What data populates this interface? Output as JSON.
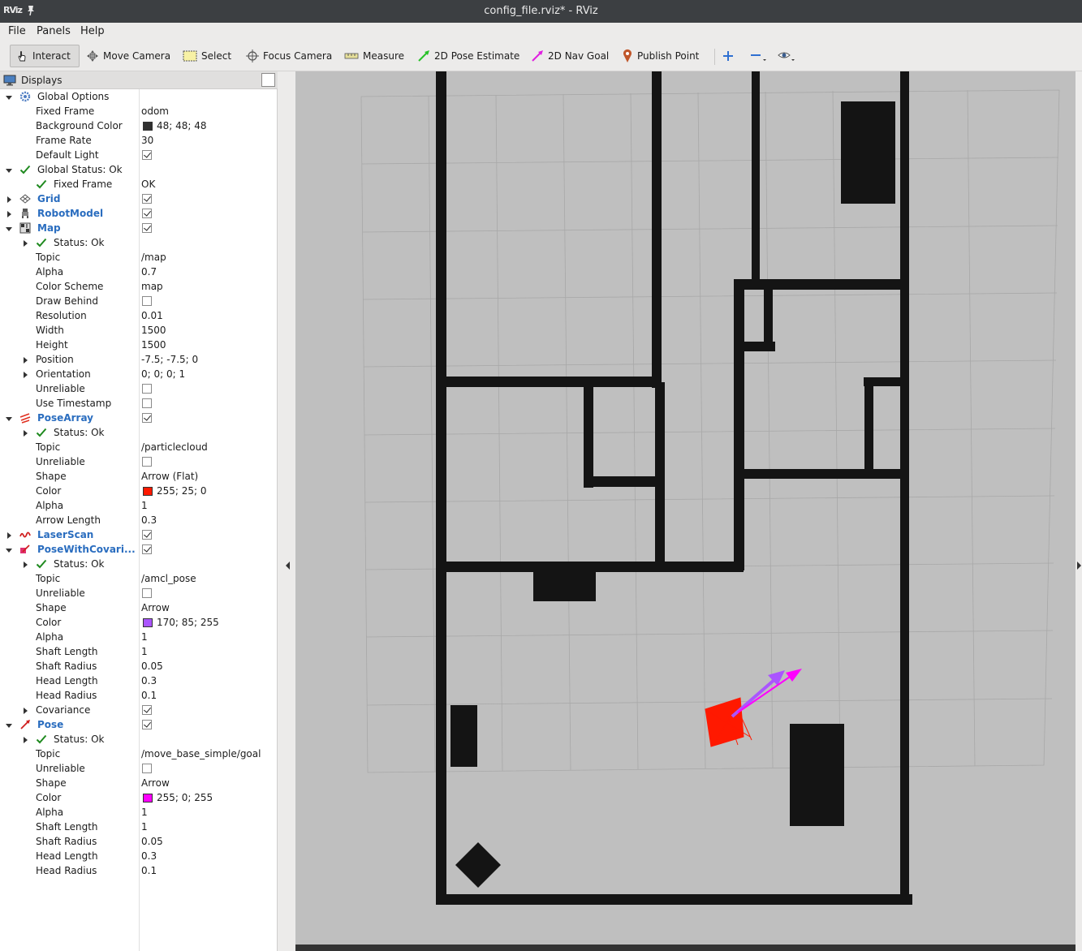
{
  "window": {
    "logo": "RViz",
    "title": "config_file.rviz* - RViz"
  },
  "menu": [
    "File",
    "Panels",
    "Help"
  ],
  "toolbar": {
    "interact": "Interact",
    "move_camera": "Move Camera",
    "select": "Select",
    "focus_camera": "Focus Camera",
    "measure": "Measure",
    "pose_estimate": "2D Pose Estimate",
    "nav_goal": "2D Nav Goal",
    "publish_point": "Publish Point"
  },
  "displays_panel": {
    "title": "Displays",
    "rows": [
      {
        "indent": 0,
        "arrow": "down",
        "icon": "gear-icon",
        "name": "Global Options",
        "group": false
      },
      {
        "indent": 1,
        "name": "Fixed Frame",
        "value": "odom"
      },
      {
        "indent": 1,
        "name": "Background Color",
        "color": "#303030",
        "value": "48; 48; 48"
      },
      {
        "indent": 1,
        "name": "Frame Rate",
        "value": "30"
      },
      {
        "indent": 1,
        "name": "Default Light",
        "checkbox": true
      },
      {
        "indent": 0,
        "arrow": "down",
        "icon": "check-icon",
        "name": "Global Status: Ok"
      },
      {
        "indent": 1,
        "icon": "check-icon",
        "name": "Fixed Frame",
        "value": "OK"
      },
      {
        "indent": 0,
        "arrow": "right",
        "icon": "grid-icon",
        "name": "Grid",
        "group": true,
        "checkbox": true
      },
      {
        "indent": 0,
        "arrow": "right",
        "icon": "robot-icon",
        "name": "RobotModel",
        "group": true,
        "checkbox": true
      },
      {
        "indent": 0,
        "arrow": "down",
        "icon": "map-icon",
        "name": "Map",
        "group": true,
        "checkbox": true
      },
      {
        "indent": 1,
        "arrow": "right",
        "icon": "check-icon",
        "name": "Status: Ok"
      },
      {
        "indent": 1,
        "name": "Topic",
        "value": "/map"
      },
      {
        "indent": 1,
        "name": "Alpha",
        "value": "0.7"
      },
      {
        "indent": 1,
        "name": "Color Scheme",
        "value": "map"
      },
      {
        "indent": 1,
        "name": "Draw Behind",
        "checkbox": false
      },
      {
        "indent": 1,
        "name": "Resolution",
        "value": "0.01"
      },
      {
        "indent": 1,
        "name": "Width",
        "value": "1500"
      },
      {
        "indent": 1,
        "name": "Height",
        "value": "1500"
      },
      {
        "indent": 1,
        "arrow": "right",
        "name": "Position",
        "value": "-7.5; -7.5; 0"
      },
      {
        "indent": 1,
        "arrow": "right",
        "name": "Orientation",
        "value": "0; 0; 0; 1"
      },
      {
        "indent": 1,
        "name": "Unreliable",
        "checkbox": false
      },
      {
        "indent": 1,
        "name": "Use Timestamp",
        "checkbox": false
      },
      {
        "indent": 0,
        "arrow": "down",
        "icon": "posearray-icon",
        "name": "PoseArray",
        "group": true,
        "checkbox": true
      },
      {
        "indent": 1,
        "arrow": "right",
        "icon": "check-icon",
        "name": "Status: Ok"
      },
      {
        "indent": 1,
        "name": "Topic",
        "value": "/particlecloud"
      },
      {
        "indent": 1,
        "name": "Unreliable",
        "checkbox": false
      },
      {
        "indent": 1,
        "name": "Shape",
        "value": "Arrow (Flat)"
      },
      {
        "indent": 1,
        "name": "Color",
        "color": "#ff1900",
        "value": "255; 25; 0"
      },
      {
        "indent": 1,
        "name": "Alpha",
        "value": "1"
      },
      {
        "indent": 1,
        "name": "Arrow Length",
        "value": "0.3"
      },
      {
        "indent": 0,
        "arrow": "right",
        "icon": "laserscan-icon",
        "name": "LaserScan",
        "group": true,
        "checkbox": true
      },
      {
        "indent": 0,
        "arrow": "down",
        "icon": "posecov-icon",
        "name": "PoseWithCovari...",
        "group": true,
        "checkbox": true
      },
      {
        "indent": 1,
        "arrow": "right",
        "icon": "check-icon",
        "name": "Status: Ok"
      },
      {
        "indent": 1,
        "name": "Topic",
        "value": "/amcl_pose"
      },
      {
        "indent": 1,
        "name": "Unreliable",
        "checkbox": false
      },
      {
        "indent": 1,
        "name": "Shape",
        "value": "Arrow"
      },
      {
        "indent": 1,
        "name": "Color",
        "color": "#aa55ff",
        "value": "170; 85; 255"
      },
      {
        "indent": 1,
        "name": "Alpha",
        "value": "1"
      },
      {
        "indent": 1,
        "name": "Shaft Length",
        "value": "1"
      },
      {
        "indent": 1,
        "name": "Shaft Radius",
        "value": "0.05"
      },
      {
        "indent": 1,
        "name": "Head Length",
        "value": "0.3"
      },
      {
        "indent": 1,
        "name": "Head Radius",
        "value": "0.1"
      },
      {
        "indent": 1,
        "arrow": "right",
        "name": "Covariance",
        "checkbox": true
      },
      {
        "indent": 0,
        "arrow": "down",
        "icon": "pose-icon",
        "name": "Pose",
        "group": true,
        "checkbox": true
      },
      {
        "indent": 1,
        "arrow": "right",
        "icon": "check-icon",
        "name": "Status: Ok"
      },
      {
        "indent": 1,
        "name": "Topic",
        "value": "/move_base_simple/goal"
      },
      {
        "indent": 1,
        "name": "Unreliable",
        "checkbox": false
      },
      {
        "indent": 1,
        "name": "Shape",
        "value": "Arrow"
      },
      {
        "indent": 1,
        "name": "Color",
        "color": "#ff00ff",
        "value": "255; 0; 255"
      },
      {
        "indent": 1,
        "name": "Alpha",
        "value": "1"
      },
      {
        "indent": 1,
        "name": "Shaft Length",
        "value": "1"
      },
      {
        "indent": 1,
        "name": "Shaft Radius",
        "value": "0.05"
      },
      {
        "indent": 1,
        "name": "Head Length",
        "value": "0.3"
      },
      {
        "indent": 1,
        "name": "Head Radius",
        "value": "0.1"
      }
    ]
  },
  "viewport": {
    "background": "#bfbfbf",
    "wall_color": "#141414",
    "particle_color": "#ff1900",
    "amcl_pose_color": "#aa55ff",
    "goal_color": "#ff00ff"
  }
}
